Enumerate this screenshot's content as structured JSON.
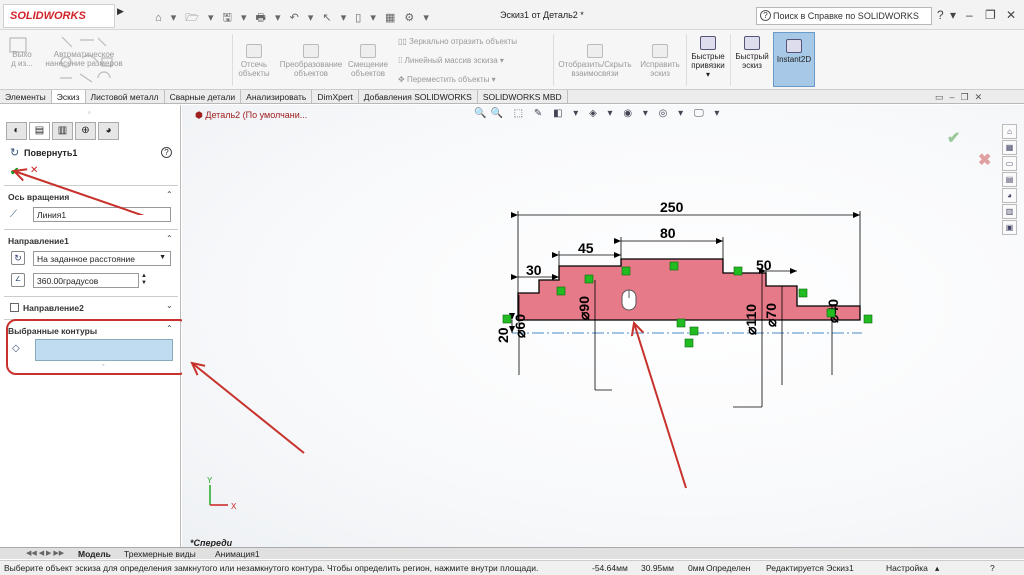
{
  "app": {
    "logo": "SOLIDWORKS",
    "window_title": "Эскиз1 от Деталь2 *",
    "search_placeholder": "Поиск в Справке по SOLIDWORKS"
  },
  "ribbon": {
    "buttons": [
      {
        "label": "Выход из эскиза",
        "l1": "Выхо",
        "l2": "д из...",
        "enabled": false
      },
      {
        "label": "Автоматическое нанесение размеров",
        "l1": "Автоматическое",
        "l2": "нанесение размеров",
        "enabled": false
      },
      {
        "label": "Отсечь объекты",
        "l1": "Отсечь",
        "l2": "объекты",
        "enabled": false
      },
      {
        "label": "Преобразование объектов",
        "l1": "Преобразование",
        "l2": "объектов",
        "enabled": false
      },
      {
        "label": "Смещение объектов",
        "l1": "Смещение",
        "l2": "объектов",
        "enabled": false
      },
      {
        "label": "Зеркально отразить объекты",
        "enabled": false
      },
      {
        "label": "Линейный массив эскиза",
        "enabled": false
      },
      {
        "label": "Переместить объекты",
        "enabled": false
      },
      {
        "label": "Отобразить/Скрыть взаимосвязи",
        "l1": "Отобразить/Скрыть",
        "l2": "взаимосвязи",
        "enabled": false
      },
      {
        "label": "Исправить эскиз",
        "l1": "Исправить",
        "l2": "эскиз",
        "enabled": false
      },
      {
        "label": "Быстрые привязки",
        "l1": "Быстрые",
        "l2": "привязки",
        "enabled": true
      },
      {
        "label": "Быстрый эскиз",
        "l1": "Быстрый",
        "l2": "эскиз",
        "enabled": true
      },
      {
        "label": "Instant2D",
        "l1": "Instant2D",
        "l2": "",
        "enabled": true
      }
    ]
  },
  "tabs": [
    "Элементы",
    "Эскиз",
    "Листовой металл",
    "Сварные детали",
    "Анализировать",
    "DimXpert",
    "Добавления SOLIDWORKS",
    "SOLIDWORKS MBD"
  ],
  "panel": {
    "title": "Повернуть1",
    "axis_section": "Ось вращения",
    "axis_value": "Линия1",
    "direction1_section": "Направление1",
    "direction1_type": "На заданное расстояние",
    "angle": "360.00градусов",
    "direction2_section": "Направление2",
    "contours_section": "Выбранные контуры",
    "contours_value": ""
  },
  "viewport": {
    "tree_label": "Деталь2 (По умолчани...",
    "orientation": "*Спереди",
    "dimensions": {
      "d250": "250",
      "d80": "80",
      "d45": "45",
      "d30": "30",
      "d50": "50",
      "d90": "90",
      "d110": "110",
      "d70": "70",
      "d20": "20",
      "d40": "40",
      "d60": "60"
    }
  },
  "bottom_tabs": [
    "Модель",
    "Трехмерные виды",
    "Анимация1"
  ],
  "status": {
    "message": "Выберите объект эскиза для определения замкнутого или незамкнутого контура. Чтобы определить регион, нажмите внутри площади.",
    "x": "-54.64мм",
    "y": "30.95мм",
    "z": "0мм",
    "state": "Определен",
    "editing": "Редактируется Эскиз1",
    "units": "Настройка"
  },
  "colors": {
    "profile_fill": "#e77a88",
    "annotation_arrow": "#c8322c",
    "relation_marker": "#22bb22",
    "axis_line": "#4a8ac8"
  }
}
